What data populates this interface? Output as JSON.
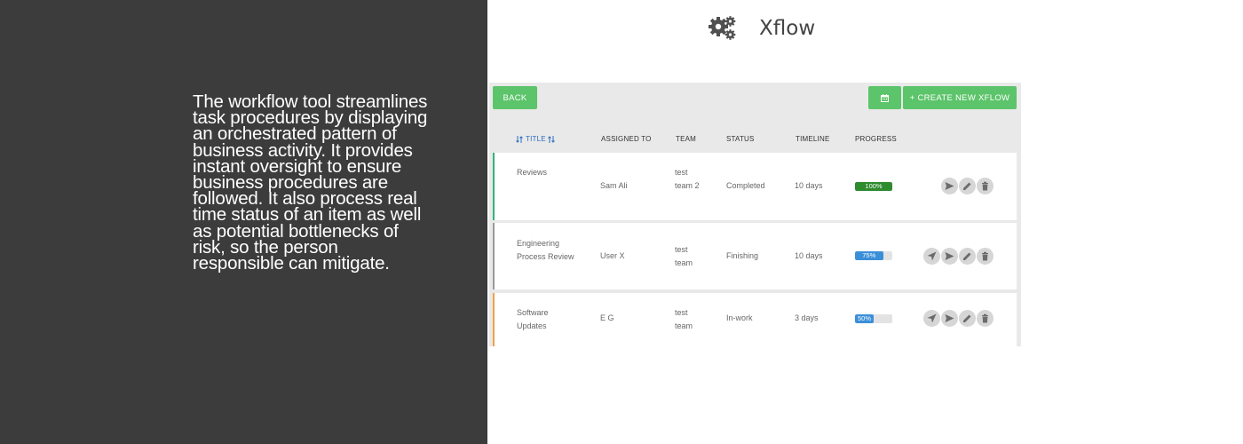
{
  "intro": {
    "text": "The workflow tool streamlines task procedures by displaying an orchestrated pattern of business activity. It provides instant oversight to ensure business procedures are followed. It also process real time status of an item as well as potential bottlenecks of risk, so the person responsible can mitigate."
  },
  "brand": {
    "icon": "gears-icon",
    "name": "Xflow"
  },
  "toolbar": {
    "back_label": "BACK",
    "calendar_icon": "calendar-icon",
    "create_label": "+ CREATE NEW XFLOW"
  },
  "table": {
    "headers": {
      "title": "TITLE",
      "assigned_to": "ASSIGNED TO",
      "team": "TEAM",
      "status": "STATUS",
      "timeline": "TIMELINE",
      "progress": "PROGRESS"
    },
    "rows": [
      {
        "title": "Reviews",
        "assigned_to": "Sam Ali",
        "team": "test team 2",
        "status": "Completed",
        "timeline": "10 days",
        "progress": 100,
        "progress_label": "100%",
        "status_color": "#33b17a",
        "actions": [
          "send-icon",
          "edit-icon",
          "delete-icon"
        ]
      },
      {
        "title": "Engineering Process Review",
        "assigned_to": "User X",
        "team": "test team",
        "status": "Finishing",
        "timeline": "10 days",
        "progress": 75,
        "progress_label": "75%",
        "status_color": "#9a9a9a",
        "actions": [
          "navigate-icon",
          "send-icon",
          "edit-icon",
          "delete-icon"
        ]
      },
      {
        "title": "Software Updates",
        "assigned_to": "E G",
        "team": "test team",
        "status": "In-work",
        "timeline": "3 days",
        "progress": 50,
        "progress_label": "50%",
        "status_color": "#f0a04b",
        "actions": [
          "navigate-icon",
          "send-icon",
          "edit-icon",
          "delete-icon"
        ]
      }
    ]
  },
  "colors": {
    "left_panel_bg": "#3c3c3c",
    "accent_green": "#5cc46a",
    "progress_complete": "#2e8b2e",
    "progress_active": "#3b8fd8"
  }
}
